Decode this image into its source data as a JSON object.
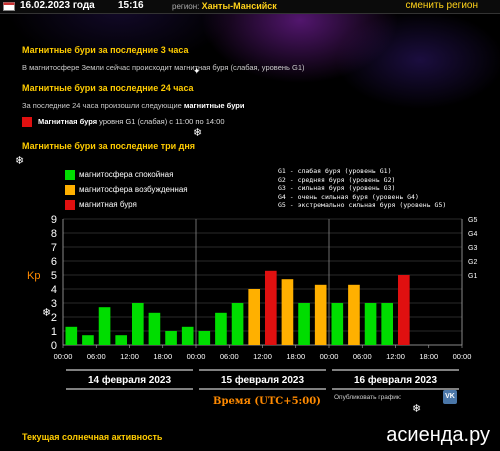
{
  "header": {
    "date": "16.02.2023 года",
    "time": "15:16",
    "region_label": "регион:",
    "region_name": "Ханты-Мансийск",
    "change_region": "сменить регион"
  },
  "section_3h": {
    "title": "Магнитные бури за последние 3 часа",
    "text": "В магнитосфере Земли сейчас происходит магнитная буря (слабая, уровень G1)"
  },
  "section_24h": {
    "title": "Магнитные бури за последние 24 часа",
    "text_prefix": "За последние 24 часа произошли следующие",
    "text_bold": "магнитные бури",
    "storm_bold": "Магнитная буря",
    "storm_text": "уровня G1 (слабая) с 11:00 по 14:00"
  },
  "section_3d": {
    "title": "Магнитные бури за последние три дня"
  },
  "legend": [
    {
      "label": "магнитосфера спокойная",
      "color": "#00dd00"
    },
    {
      "label": "магнитосфера возбужденная",
      "color": "#ffb000"
    },
    {
      "label": "магнитная буря",
      "color": "#e01010"
    }
  ],
  "g_levels": [
    "G1 - слабая буря (уровень G1)",
    "G2 - средняя буря (уровень G2)",
    "G3 - сильная буря (уровень G3)",
    "G4 - очень сильная буря (уровень G4)",
    "G5 - экстремально сильная буря (уровень G5)"
  ],
  "chart_data": {
    "type": "bar",
    "ylabel": "Kp",
    "xlabel": "Время (UTC+5:00)",
    "ylim": [
      0,
      9
    ],
    "y_ticks": [
      "0",
      "1",
      "2",
      "3",
      "4",
      "5",
      "6",
      "7",
      "8",
      "9"
    ],
    "right_ticks": [
      {
        "label": "G1",
        "kp": 5
      },
      {
        "label": "G2",
        "kp": 6
      },
      {
        "label": "G3",
        "kp": 7
      },
      {
        "label": "G4",
        "kp": 8
      },
      {
        "label": "G5",
        "kp": 9
      }
    ],
    "x_tick_labels": [
      "00:00",
      "06:00",
      "12:00",
      "18:00",
      "00:00",
      "06:00",
      "12:00",
      "18:00",
      "00:00",
      "06:00",
      "12:00",
      "18:00",
      "00:00"
    ],
    "days": [
      "14 февраля 2023",
      "15 февраля 2023",
      "16 февраля 2023"
    ],
    "values": [
      1.3,
      0.7,
      2.7,
      0.7,
      3.0,
      2.3,
      1.0,
      1.3,
      1.0,
      2.3,
      3.0,
      4.0,
      5.3,
      4.7,
      3.0,
      4.3,
      3.0,
      4.3,
      3.0,
      3.0,
      5.0
    ],
    "levels": [
      "quiet",
      "quiet",
      "quiet",
      "quiet",
      "quiet",
      "quiet",
      "quiet",
      "quiet",
      "quiet",
      "quiet",
      "quiet",
      "active",
      "storm",
      "active",
      "quiet",
      "active",
      "quiet",
      "active",
      "quiet",
      "quiet",
      "storm"
    ],
    "colors": {
      "quiet": "#00dd00",
      "active": "#ffb000",
      "storm": "#e01010"
    },
    "grid": true
  },
  "footer": {
    "xlabel": "Время (UTC+5:00)",
    "share_label": "Опубликовать график:",
    "vk_label": "VK",
    "solar_title": "Текущая солнечная активность",
    "watermark": "асиенда.ру"
  }
}
